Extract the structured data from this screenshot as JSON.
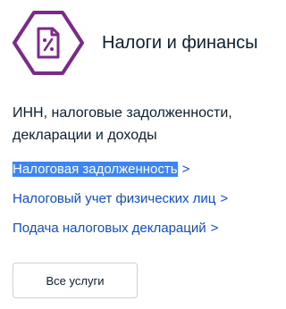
{
  "section": {
    "title": "Налоги и финансы",
    "icon": "tax-document-icon",
    "description": "ИНН, налоговые задолженности, декларации и доходы"
  },
  "links": [
    {
      "label": "Налоговая задолженность",
      "chevron": ">",
      "selected": true
    },
    {
      "label": "Налоговый учет физических лиц",
      "chevron": ">"
    },
    {
      "label": "Подача налоговых деклараций",
      "chevron": ">"
    }
  ],
  "all_services_button": {
    "label": "Все услуги"
  },
  "colors": {
    "brand_purple": "#7b2a8c",
    "link_blue": "#0d4cd3",
    "selection_blue": "#3d84f7",
    "text": "#0b1f33",
    "button_border": "#cdd1d4"
  }
}
